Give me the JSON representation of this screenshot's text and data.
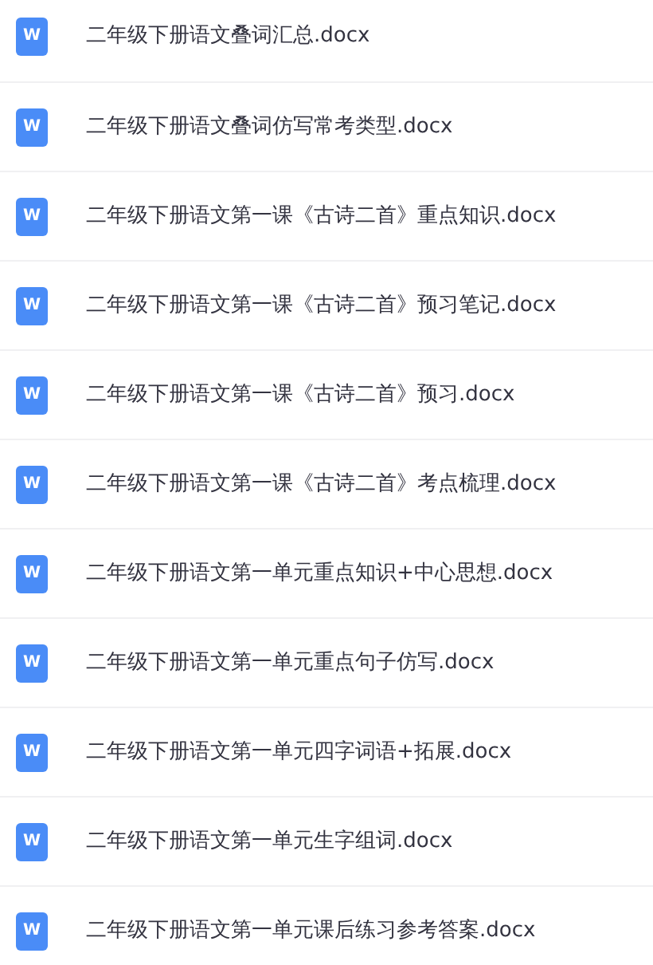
{
  "files": [
    {
      "icon_label": "W",
      "name": "二年级下册语文叠词汇总.docx"
    },
    {
      "icon_label": "W",
      "name": "二年级下册语文叠词仿写常考类型.docx"
    },
    {
      "icon_label": "W",
      "name": "二年级下册语文第一课《古诗二首》重点知识.docx"
    },
    {
      "icon_label": "W",
      "name": "二年级下册语文第一课《古诗二首》预习笔记.docx"
    },
    {
      "icon_label": "W",
      "name": "二年级下册语文第一课《古诗二首》预习.docx"
    },
    {
      "icon_label": "W",
      "name": "二年级下册语文第一课《古诗二首》考点梳理.docx"
    },
    {
      "icon_label": "W",
      "name": "二年级下册语文第一单元重点知识+中心思想.docx"
    },
    {
      "icon_label": "W",
      "name": "二年级下册语文第一单元重点句子仿写.docx"
    },
    {
      "icon_label": "W",
      "name": "二年级下册语文第一单元四字词语+拓展.docx"
    },
    {
      "icon_label": "W",
      "name": "二年级下册语文第一单元生字组词.docx"
    },
    {
      "icon_label": "W",
      "name": "二年级下册语文第一单元课后练习参考答案.docx"
    }
  ]
}
